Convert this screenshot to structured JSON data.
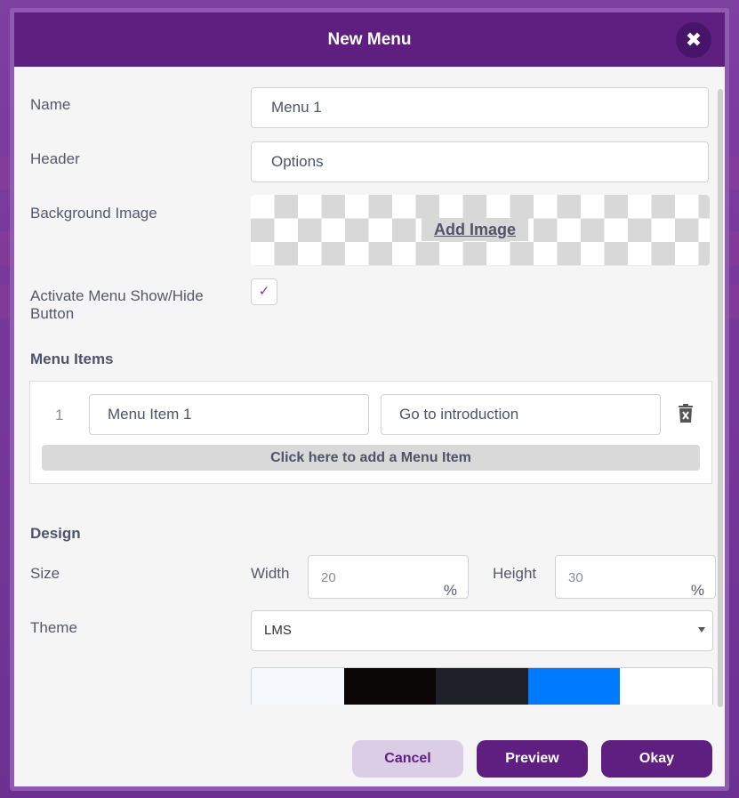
{
  "dialog": {
    "title": "New Menu"
  },
  "fields": {
    "name_label": "Name",
    "name_value": "Menu 1",
    "header_label": "Header",
    "header_value": "Options",
    "background_label": "Background Image",
    "add_image_label": "Add Image",
    "activate_label": "Activate Menu Show/Hide Button",
    "activate_checked": true
  },
  "menu_items": {
    "section_title": "Menu Items",
    "items": [
      {
        "number": "1",
        "label": "Menu Item 1",
        "action": "Go to introduction"
      }
    ],
    "add_label": "Click here to add a Menu Item"
  },
  "design": {
    "section_title": "Design",
    "size_label": "Size",
    "width_label": "Width",
    "width_value": "20",
    "width_unit": "%",
    "height_label": "Height",
    "height_value": "30",
    "height_unit": "%",
    "theme_label": "Theme",
    "theme_value": "LMS",
    "theme_colors": [
      "#f5f8fc",
      "#0a0706",
      "#1e2228",
      "#007bff",
      "#ffffff"
    ]
  },
  "footer": {
    "cancel_label": "Cancel",
    "preview_label": "Preview",
    "okay_label": "Okay"
  },
  "colors": {
    "header": "#5e1f80",
    "accent": "#5e1f80",
    "cancel_bg": "#dccde6"
  }
}
